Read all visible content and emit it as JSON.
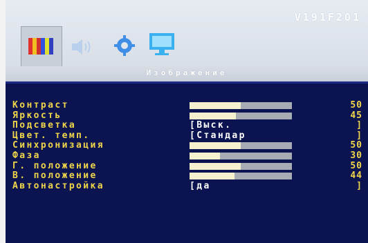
{
  "header": {
    "model": "V191F201",
    "subtitle": "Изображение",
    "tabs": [
      {
        "icon": "color-bars-icon"
      },
      {
        "icon": "speaker-icon"
      },
      {
        "icon": "gear-icon"
      },
      {
        "icon": "monitor-icon"
      }
    ]
  },
  "menu": {
    "rows": [
      {
        "label": "Контраст",
        "type": "slider",
        "value": "50",
        "level": 50
      },
      {
        "label": "Яркость",
        "type": "slider",
        "value": "45",
        "level": 45
      },
      {
        "label": "Подсветка",
        "type": "option",
        "option": "[Выск.",
        "bracket": "]"
      },
      {
        "label": "Цвет. темп.",
        "type": "option",
        "option": "[Стандар",
        "bracket": "]"
      },
      {
        "label": "Синхронизация",
        "type": "slider",
        "value": "50",
        "level": 50
      },
      {
        "label": "Фаза",
        "type": "slider",
        "value": "30",
        "level": 30
      },
      {
        "label": "Г. положение",
        "type": "slider",
        "value": "50",
        "level": 50
      },
      {
        "label": "В. положение",
        "type": "slider",
        "value": "44",
        "level": 44
      },
      {
        "label": "Автонастройка",
        "type": "option",
        "option": "[да",
        "bracket": "]"
      }
    ]
  },
  "colors": {
    "panel": "#0b1350",
    "label": "#f0d64a",
    "bar_track": "#a7abb4",
    "bar_fill": "#f5f1cf"
  }
}
